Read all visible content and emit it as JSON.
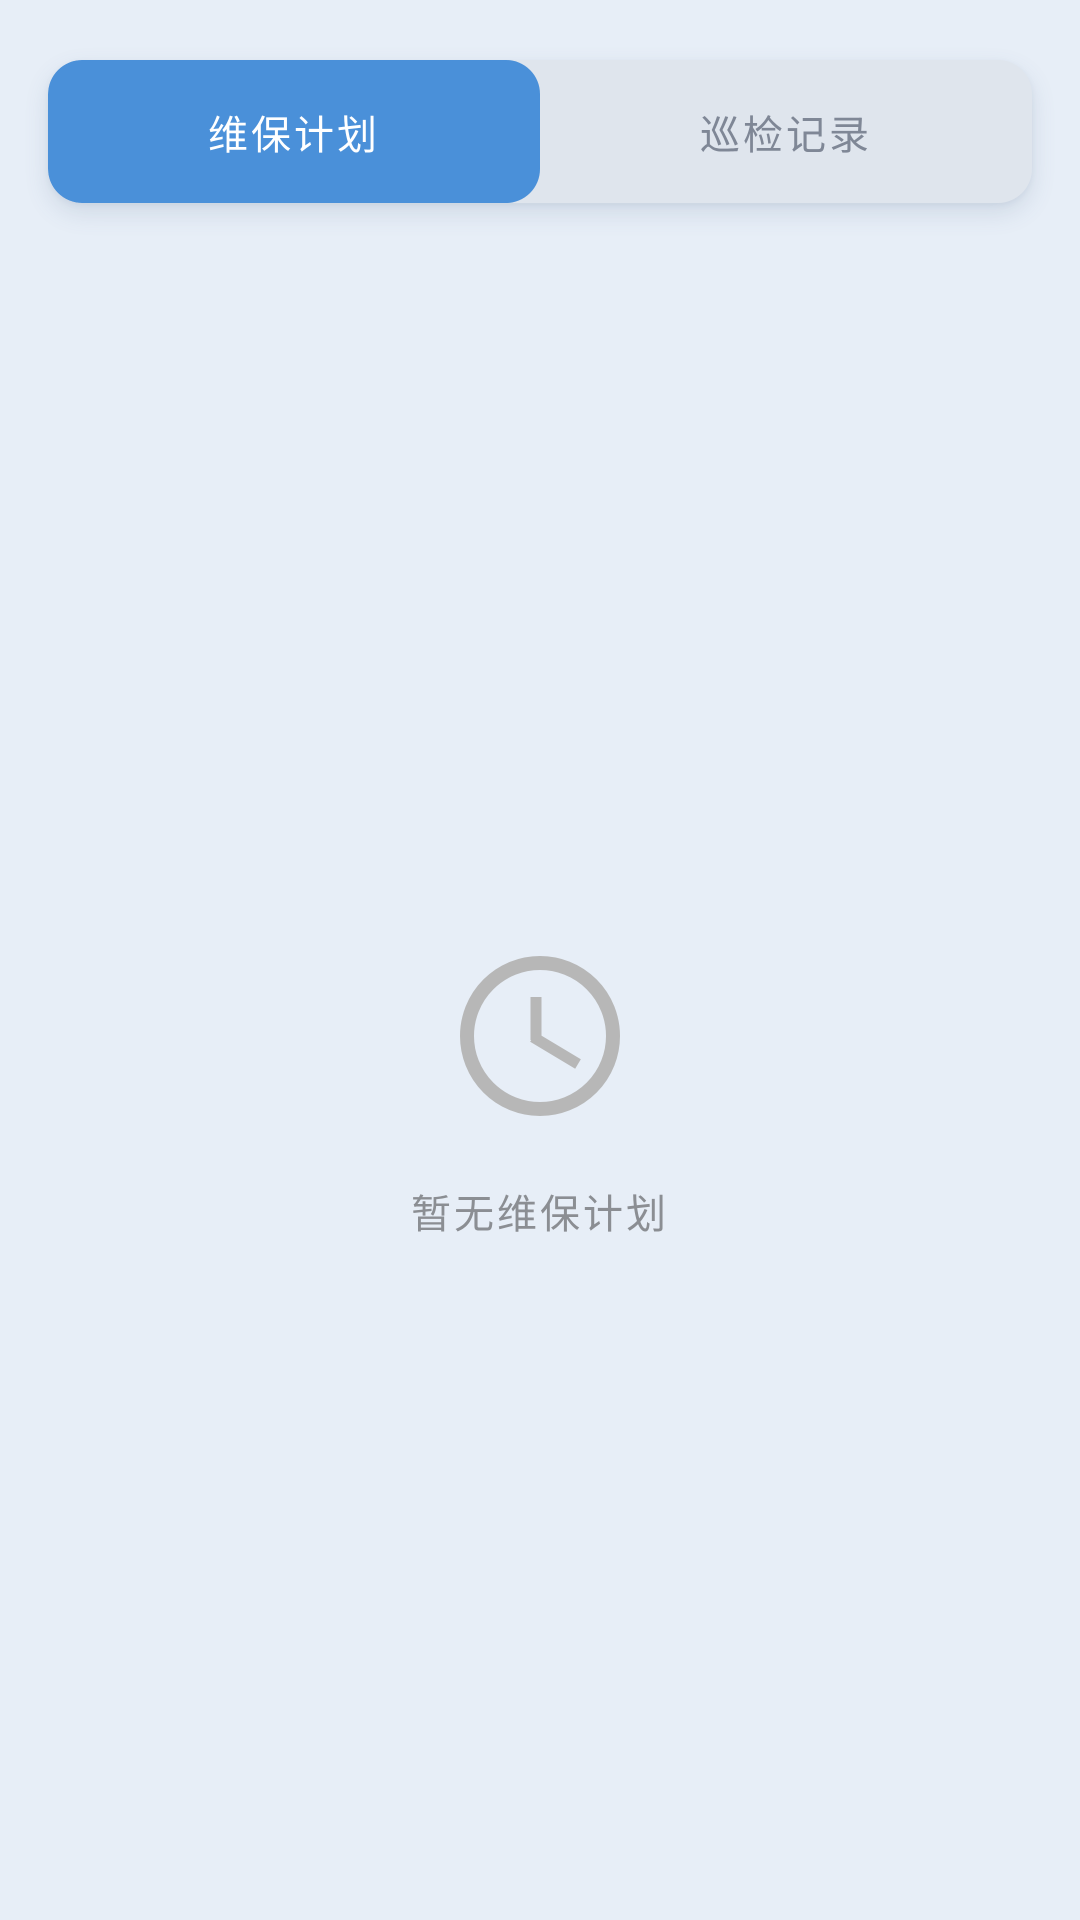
{
  "tabs": [
    {
      "label": "维保计划",
      "active": true
    },
    {
      "label": "巡检记录",
      "active": false
    }
  ],
  "empty_state": {
    "icon": "clock-icon",
    "message": "暂无维保计划"
  },
  "colors": {
    "background": "#e7eef7",
    "tab_bar": "#dfe5ed",
    "accent": "#4a90d9",
    "active_text": "#ffffff",
    "inactive_text": "#7f8796",
    "icon": "#b7b7b7",
    "empty_text": "#8b8e93"
  }
}
